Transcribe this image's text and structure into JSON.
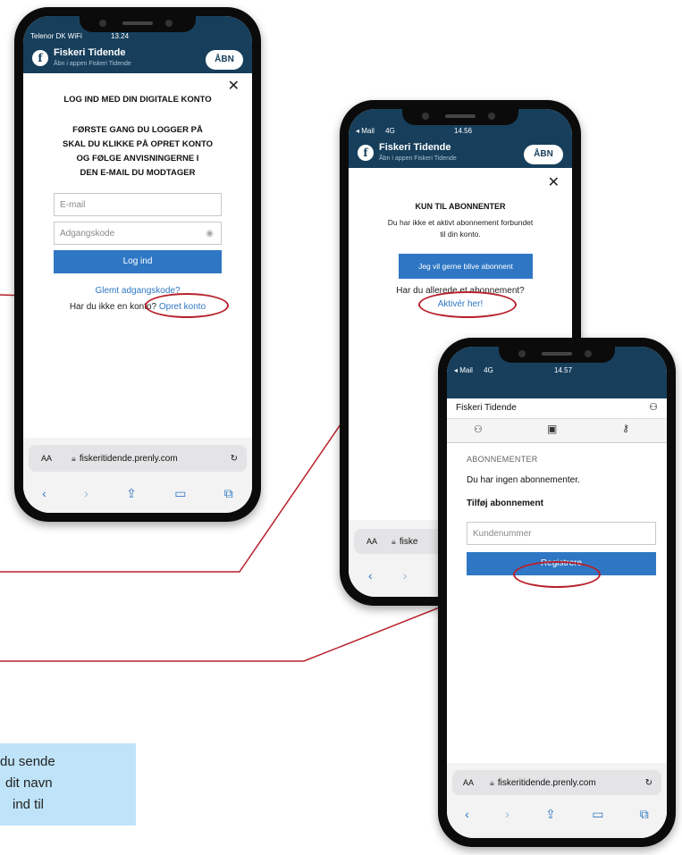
{
  "phone1": {
    "status_left": "Telenor DK WiFi",
    "status_time": "13.24",
    "banner_title": "Fiskeri Tidende",
    "banner_subtitle": "Åbn i appen Fiskeri Tidende",
    "open_label": "ÅBN",
    "close_symbol": "✕",
    "heading": "LOG IND MED DIN DIGITALE KONTO",
    "instructions": [
      "FØRSTE GANG DU LOGGER PÅ",
      "SKAL DU KLIKKE PÅ OPRET KONTO",
      "OG FØLGE ANVISNINGERNE I",
      "DEN E-MAIL DU MODTAGER"
    ],
    "email_placeholder": "E-mail",
    "password_placeholder": "Adgangskode",
    "login_label": "Log ind",
    "forgot_label": "Glemt adgangskode?",
    "no_account_text": "Har du ikke en konto?",
    "create_account_label": "Opret konto",
    "url": "fiskeritidende.prenly.com",
    "aa": "AA"
  },
  "phone2": {
    "status_left": "◂ Mail",
    "status_net": "4G",
    "status_time": "14.56",
    "banner_title": "Fiskeri Tidende",
    "banner_subtitle": "Åbn i appen Fiskeri Tidende",
    "open_label": "ÅBN",
    "close_symbol": "✕",
    "heading": "KUN TIL ABONNENTER",
    "text": [
      "Du har ikke et aktivt abonnement forbundet",
      "til din konto."
    ],
    "subscribe_label": "Jeg vil gerne blive abonnent",
    "already_text": "Har du allerede et abonnement?",
    "activate_label": "Aktivér her!",
    "url_partial": "fiske",
    "aa": "AA"
  },
  "phone3": {
    "status_left": "◂ Mail",
    "status_net": "4G",
    "status_time": "14.57",
    "app_title": "Fiskeri Tidende",
    "section_label": "ABONNEMENTER",
    "no_subs": "Du har ingen abonnementer.",
    "add_label": "Tilføj abonnement",
    "customer_placeholder": "Kundenummer",
    "register_label": "Registrere",
    "url": "fiskeritidendе.prenly.com",
    "aa": "AA"
  },
  "note_lines": [
    "du sende",
    "dit navn",
    "ind til"
  ],
  "colors": {
    "banner": "#173f5c",
    "button": "#2f77c4",
    "annotation": "#b8212c",
    "note_bg": "#bfe3f8"
  }
}
